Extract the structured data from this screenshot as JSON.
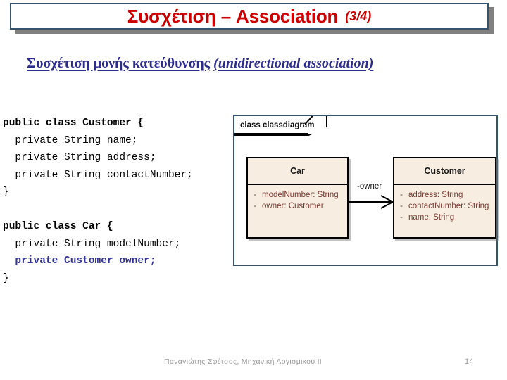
{
  "slide": {
    "title_main": "Συσχέτιση – Association",
    "title_counter": "(3/4)",
    "subtitle_greek": "Συσχέτιση μονής κατεύθυνσης",
    "subtitle_english": "(unidirectional association)",
    "colors": {
      "title_text": "#CC0000",
      "title_border": "#36546f",
      "title_shadow": "#808080",
      "subtitle": "#2D2D8C",
      "code_highlight": "#333399",
      "uml_fill": "#F7EDE0",
      "uml_attr_text": "#7a3a33",
      "footer_text": "#9a9a9a"
    }
  },
  "code": {
    "lines": [
      {
        "text": "public class Customer {",
        "style": "kw"
      },
      {
        "text": "  private String name;",
        "style": "plain"
      },
      {
        "text": "  private String address;",
        "style": "plain"
      },
      {
        "text": "  private String contactNumber;",
        "style": "plain"
      },
      {
        "text": "}",
        "style": "plain"
      },
      {
        "text": "",
        "style": "blank"
      },
      {
        "text": "public class Car {",
        "style": "kw"
      },
      {
        "text": "  private String modelNumber;",
        "style": "plain"
      },
      {
        "text": "  private Customer owner;",
        "style": "ref"
      },
      {
        "text": "}",
        "style": "plain"
      }
    ]
  },
  "diagram": {
    "frame_label": "class classdiagram",
    "association_label": "-owner",
    "classes": [
      {
        "name": "Car",
        "attributes": [
          {
            "visibility": "-",
            "text": "modelNumber: String"
          },
          {
            "visibility": "-",
            "text": "owner: Customer"
          }
        ]
      },
      {
        "name": "Customer",
        "attributes": [
          {
            "visibility": "-",
            "text": "address: String"
          },
          {
            "visibility": "-",
            "text": "contactNumber: String"
          },
          {
            "visibility": "-",
            "text": "name: String"
          }
        ]
      }
    ]
  },
  "footer": {
    "author": "Παναγιώτης Σφέτσος,  Μηχανική Λογισμικού ΙΙ",
    "page_number": "14"
  }
}
